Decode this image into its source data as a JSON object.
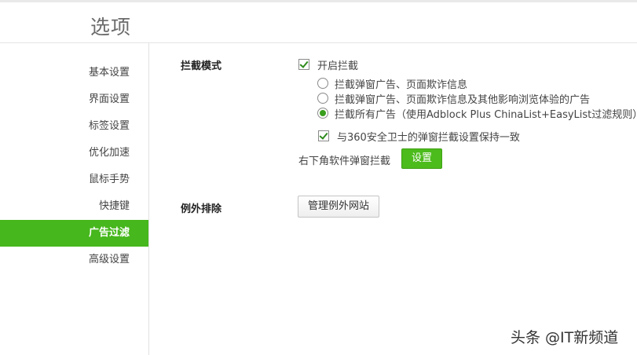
{
  "header": {
    "title": "选项"
  },
  "sidebar": {
    "items": [
      {
        "label": "基本设置"
      },
      {
        "label": "界面设置"
      },
      {
        "label": "标签设置"
      },
      {
        "label": "优化加速"
      },
      {
        "label": "鼠标手势"
      },
      {
        "label": "快捷键"
      },
      {
        "label": "广告过滤",
        "active": true
      },
      {
        "label": "高级设置"
      }
    ]
  },
  "main": {
    "block_mode": {
      "label": "拦截模式",
      "enable_checkbox": {
        "label": "开启拦截",
        "checked": true
      },
      "radio_options": [
        {
          "label": "拦截弹窗广告、页面欺诈信息",
          "selected": false
        },
        {
          "label": "拦截弹窗广告、页面欺诈信息及其他影响浏览体验的广告",
          "selected": false
        },
        {
          "label": "拦截所有广告（使用Adblock Plus ChinaList+EasyList过滤规则）",
          "selected": true
        }
      ],
      "sync_checkbox": {
        "label": "与360安全卫士的弹窗拦截设置保持一致",
        "checked": true
      },
      "popup_block": {
        "label": "右下角软件弹窗拦截",
        "button_label": "设置"
      }
    },
    "exceptions": {
      "label": "例外排除",
      "button_label": "管理例外网站"
    }
  },
  "watermark": {
    "text": "头条 @IT新频道"
  },
  "colors": {
    "accent_green": "#46b71c",
    "button_green": "#4cbb1c"
  }
}
